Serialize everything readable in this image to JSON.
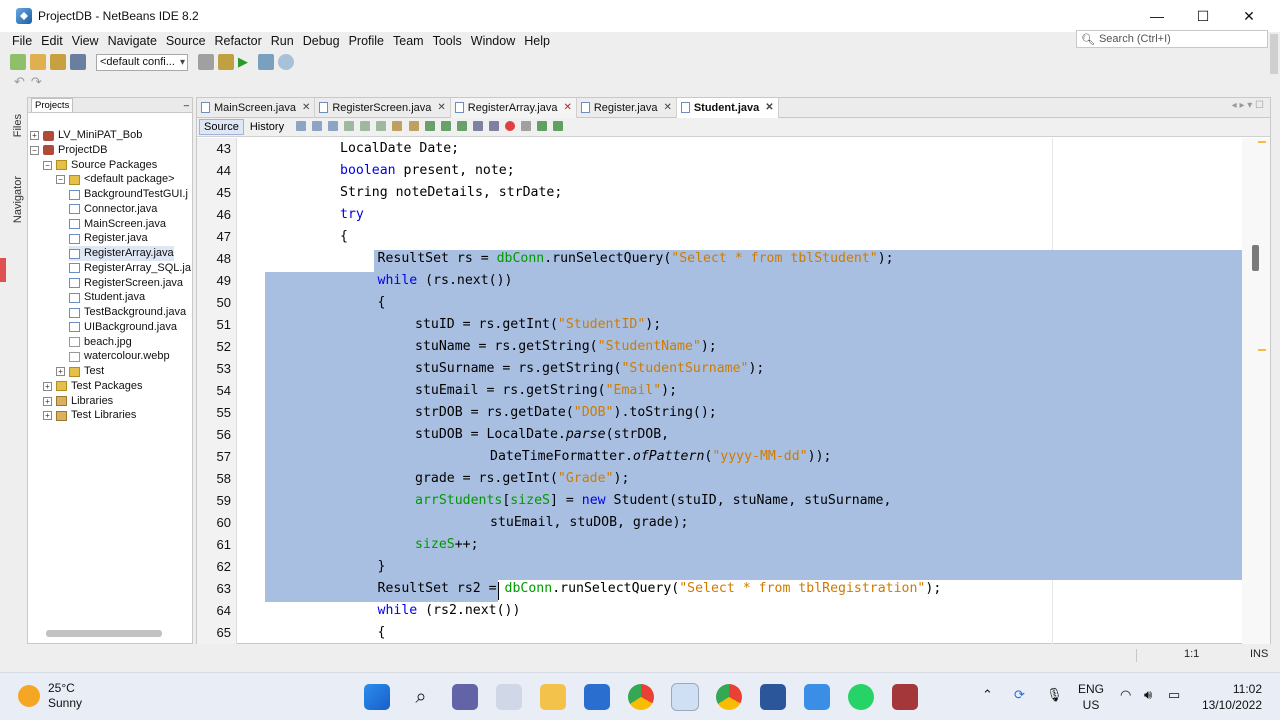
{
  "window": {
    "title": "ProjectDB - NetBeans IDE 8.2",
    "controls": {
      "minimize": "—",
      "maximize": "☐",
      "close": "✕"
    }
  },
  "menu": [
    "File",
    "Edit",
    "View",
    "Navigate",
    "Source",
    "Refactor",
    "Run",
    "Debug",
    "Profile",
    "Team",
    "Tools",
    "Window",
    "Help"
  ],
  "search": {
    "placeholder": "Search (Ctrl+I)"
  },
  "toolbar": {
    "config": "<default confi..."
  },
  "side_tabs": {
    "files": "Files",
    "navigator": "Navigator"
  },
  "projects": {
    "tab": "Projects",
    "minimize": "‒",
    "tree": [
      {
        "label": "LV_MiniPAT_Bob",
        "indent": 0,
        "toggle": "+",
        "icon": "proj"
      },
      {
        "label": "ProjectDB",
        "indent": 0,
        "toggle": "−",
        "icon": "proj"
      },
      {
        "label": "Source Packages",
        "indent": 1,
        "toggle": "−",
        "icon": "pkg"
      },
      {
        "label": "<default package>",
        "indent": 2,
        "toggle": "−",
        "icon": "pkg"
      },
      {
        "label": "BackgroundTestGUI.j",
        "indent": 3,
        "toggle": "",
        "icon": "java"
      },
      {
        "label": "Connector.java",
        "indent": 3,
        "toggle": "",
        "icon": "java"
      },
      {
        "label": "MainScreen.java",
        "indent": 3,
        "toggle": "",
        "icon": "java"
      },
      {
        "label": "Register.java",
        "indent": 3,
        "toggle": "",
        "icon": "java"
      },
      {
        "label": "RegisterArray.java",
        "indent": 3,
        "toggle": "",
        "icon": "java",
        "selected": true
      },
      {
        "label": "RegisterArray_SQL.ja",
        "indent": 3,
        "toggle": "",
        "icon": "java"
      },
      {
        "label": "RegisterScreen.java",
        "indent": 3,
        "toggle": "",
        "icon": "java"
      },
      {
        "label": "Student.java",
        "indent": 3,
        "toggle": "",
        "icon": "java"
      },
      {
        "label": "TestBackground.java",
        "indent": 3,
        "toggle": "",
        "icon": "java"
      },
      {
        "label": "UIBackground.java",
        "indent": 3,
        "toggle": "",
        "icon": "java"
      },
      {
        "label": "beach.jpg",
        "indent": 3,
        "toggle": "",
        "icon": "file"
      },
      {
        "label": "watercolour.webp",
        "indent": 3,
        "toggle": "",
        "icon": "file"
      },
      {
        "label": "Test",
        "indent": 2,
        "toggle": "+",
        "icon": "pkg"
      },
      {
        "label": "Test Packages",
        "indent": 1,
        "toggle": "+",
        "icon": "pkg"
      },
      {
        "label": "Libraries",
        "indent": 1,
        "toggle": "+",
        "icon": "lib"
      },
      {
        "label": "Test Libraries",
        "indent": 1,
        "toggle": "+",
        "icon": "lib"
      }
    ]
  },
  "editor": {
    "tabs": [
      {
        "label": "MainScreen.java",
        "state": "normal"
      },
      {
        "label": "RegisterScreen.java",
        "state": "normal"
      },
      {
        "label": "RegisterArray.java",
        "state": "mid"
      },
      {
        "label": "Register.java",
        "state": "normal"
      },
      {
        "label": "Student.java",
        "state": "active"
      }
    ],
    "close_glyph": "✕",
    "source_tab": "Source",
    "history_tab": "History",
    "lines": [
      {
        "n": "43",
        "ind": 0,
        "html": "LocalDate Date;"
      },
      {
        "n": "44",
        "ind": 0,
        "html": "<span class=\"kw\">boolean</span> present, note;"
      },
      {
        "n": "45",
        "ind": 0,
        "html": "String noteDetails, strDate;"
      },
      {
        "n": "46",
        "ind": 0,
        "html": "<span class=\"kw\">try</span>"
      },
      {
        "n": "47",
        "ind": 0,
        "html": "{"
      },
      {
        "n": "48",
        "ind": 1,
        "html": "ResultSet rs = <span class=\"fld\">dbConn</span>.runSelectQuery(<span class=\"str\">\"Select * from tblStudent\"</span>);"
      },
      {
        "n": "49",
        "ind": 1,
        "html": "<span class=\"kw\">while</span> (rs.next())"
      },
      {
        "n": "50",
        "ind": 1,
        "html": "{"
      },
      {
        "n": "51",
        "ind": 2,
        "html": "stuID = rs.getInt(<span class=\"str\">\"StudentID\"</span>);"
      },
      {
        "n": "52",
        "ind": 2,
        "html": "stuName = rs.getString(<span class=\"str\">\"StudentName\"</span>);"
      },
      {
        "n": "53",
        "ind": 2,
        "html": "stuSurname = rs.getString(<span class=\"str\">\"StudentSurname\"</span>);"
      },
      {
        "n": "54",
        "ind": 2,
        "html": "stuEmail = rs.getString(<span class=\"str\">\"Email\"</span>);"
      },
      {
        "n": "55",
        "ind": 2,
        "html": "strDOB = rs.getDate(<span class=\"str\">\"DOB\"</span>).toString();"
      },
      {
        "n": "56",
        "ind": 2,
        "html": "stuDOB = LocalDate.<span class=\"it\">parse</span>(strDOB,"
      },
      {
        "n": "57",
        "ind": 4,
        "html": "DateTimeFormatter.<span class=\"it\">ofPattern</span>(<span class=\"str\">\"yyyy-MM-dd\"</span>));"
      },
      {
        "n": "58",
        "ind": 2,
        "html": "grade = rs.getInt(<span class=\"str\">\"Grade\"</span>);"
      },
      {
        "n": "59",
        "ind": 2,
        "html": "<span class=\"fld\">arrStudents</span>[<span class=\"fld\">sizeS</span>] = <span class=\"kw\">new</span> Student(stuID, stuName, stuSurname,"
      },
      {
        "n": "60",
        "ind": 4,
        "html": "stuEmail, stuDOB, grade);"
      },
      {
        "n": "61",
        "ind": 2,
        "html": "<span class=\"fld\">sizeS</span>++;"
      },
      {
        "n": "62",
        "ind": 1,
        "html": "}"
      },
      {
        "n": "63",
        "ind": 1,
        "html": "ResultSet rs2 = <span class=\"fld\">dbConn</span>.runSelectQuery(<span class=\"str\">\"Select * from tblRegistration\"</span>);"
      },
      {
        "n": "64",
        "ind": 1,
        "html": "<span class=\"kw\">while</span> (rs2.next())"
      },
      {
        "n": "65",
        "ind": 1,
        "html": "{"
      }
    ]
  },
  "status": {
    "position": "1:1",
    "mode": "INS"
  },
  "taskbar": {
    "temp": "25°C",
    "weather": "Sunny",
    "lang1": "ENG",
    "lang2": "US",
    "time": "11:02",
    "date": "13/10/2022"
  }
}
